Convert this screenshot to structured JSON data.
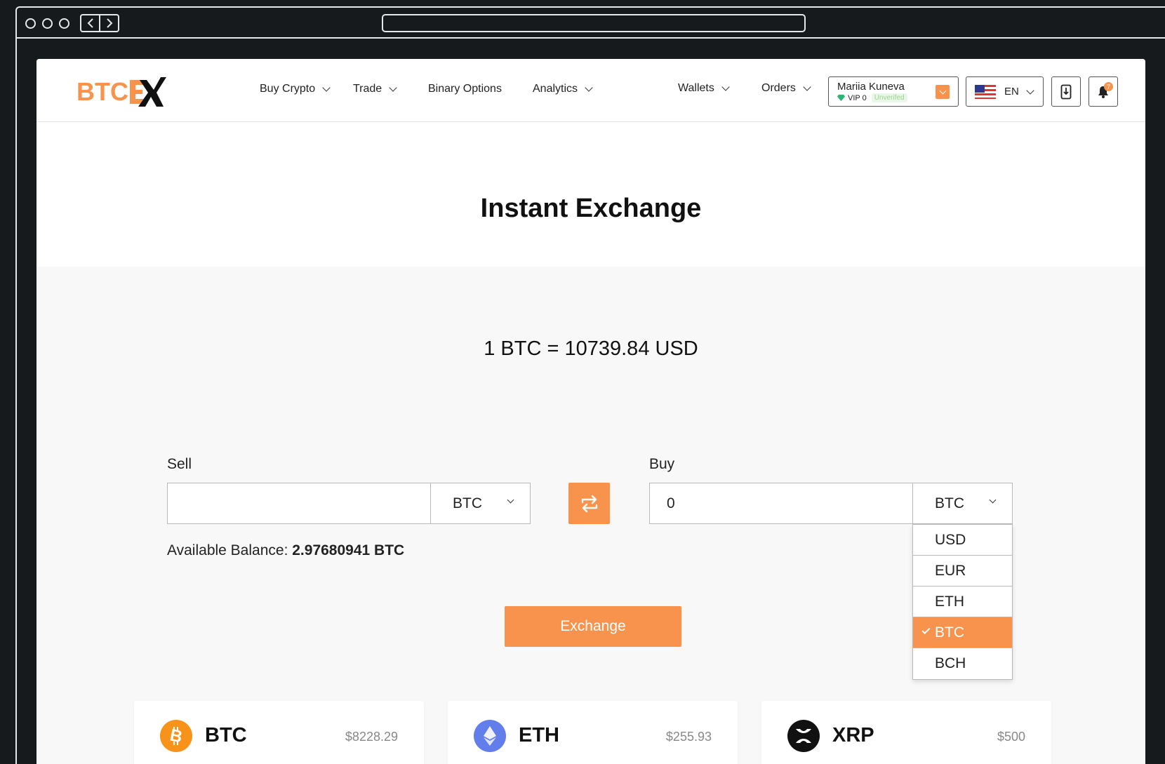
{
  "header": {
    "logo_text": "BTC",
    "logo_mark": "EX",
    "nav": [
      {
        "label": "Buy Crypto"
      },
      {
        "label": "Trade"
      },
      {
        "label": "Binary Options"
      },
      {
        "label": "Analytics"
      },
      {
        "label": "Wallets"
      },
      {
        "label": "Orders"
      }
    ],
    "user": {
      "name": "Mariia Kuneva",
      "vip": "VIP 0",
      "status": "Unverifed"
    },
    "language": "EN",
    "notification_count": "7"
  },
  "main": {
    "title": "Instant Exchange",
    "rate": "1 BTC = 10739.84 USD",
    "sell": {
      "label": "Sell",
      "value": "",
      "currency": "BTC"
    },
    "buy": {
      "label": "Buy",
      "value": "0",
      "currency": "BTC"
    },
    "balance_label": "Available Balance:",
    "balance_value": "2.97680941 BTC",
    "dropdown_options": [
      "USD",
      "EUR",
      "ETH",
      "BTC",
      "BCH"
    ],
    "dropdown_selected": "BTC",
    "exchange_button": "Exchange"
  },
  "coins": [
    {
      "symbol": "BTC",
      "price": "$8228.29",
      "color": "#f7931a",
      "icon": "bitcoin-icon"
    },
    {
      "symbol": "ETH",
      "price": "$255.93",
      "color": "#627eea",
      "icon": "ethereum-icon"
    },
    {
      "symbol": "XRP",
      "price": "$500",
      "color": "#111111",
      "icon": "xrp-icon"
    }
  ],
  "colors": {
    "accent": "#f7934c",
    "chrome": "#161a1c"
  }
}
